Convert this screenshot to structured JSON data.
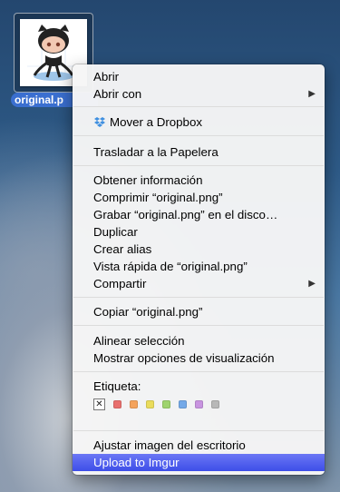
{
  "desktop": {
    "file_name": "original.p"
  },
  "menu": {
    "open": "Abrir",
    "open_with": "Abrir con",
    "dropbox_move": "Mover a Dropbox",
    "trash": "Trasladar a la Papelera",
    "get_info": "Obtener información",
    "compress": "Comprimir “original.png”",
    "burn": "Grabar “original.png” en el disco…",
    "duplicate": "Duplicar",
    "make_alias": "Crear alias",
    "quick_look": "Vista rápida de “original.png”",
    "share": "Compartir",
    "copy": "Copiar “original.png”",
    "align_selection": "Alinear selección",
    "view_options": "Mostrar opciones de visualización",
    "label_heading": "Etiqueta:",
    "tag_none_glyph": "✕",
    "tag_colors": [
      "#e8706e",
      "#f4a35c",
      "#eadc5c",
      "#9fd36e",
      "#74a9e8",
      "#c894e0",
      "#b8b8b8"
    ],
    "set_desktop": "Ajustar imagen del escritorio",
    "upload_imgur": "Upload to Imgur"
  }
}
